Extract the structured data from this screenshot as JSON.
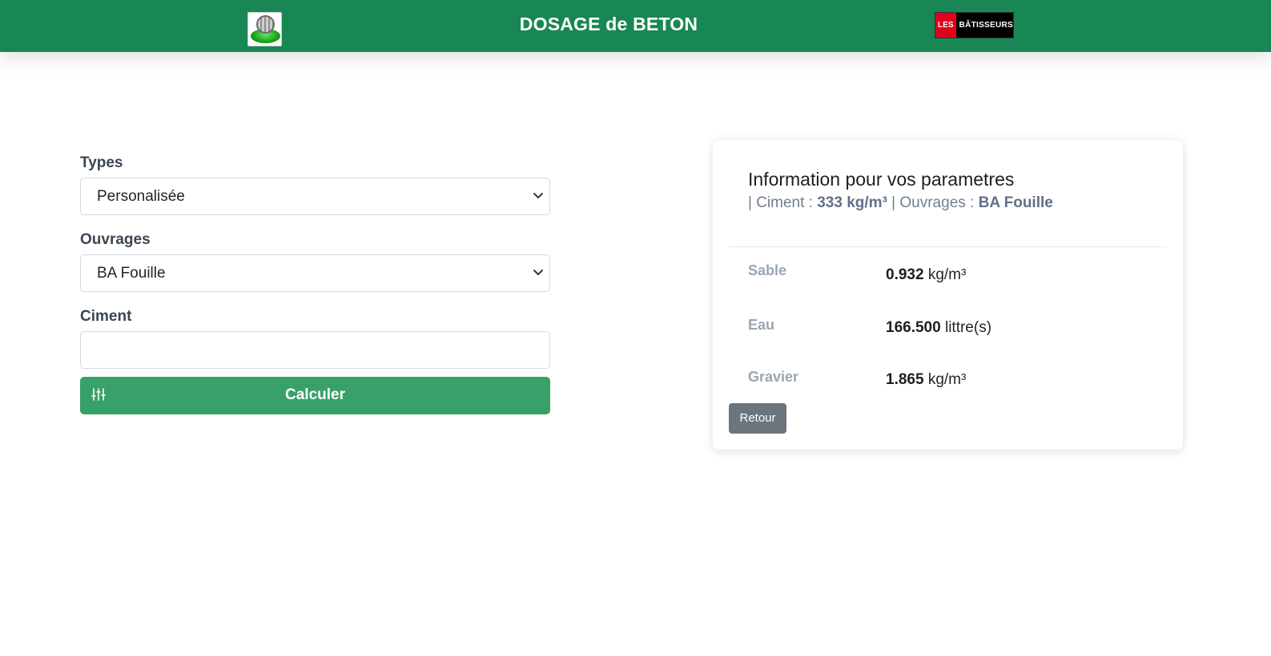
{
  "header": {
    "title": "DOSAGE de BETON",
    "logo_right": {
      "part1": "LES",
      "part2": "BÂTISSEURS"
    }
  },
  "form": {
    "types_label": "Types",
    "types_value": "Personalisée",
    "ouvrages_label": "Ouvrages",
    "ouvrages_value": "BA Fouille",
    "ciment_label": "Ciment",
    "ciment_value": "",
    "calc_button": "Calculer"
  },
  "result": {
    "title": "Information pour vos parametres",
    "sub_prefix_ciment": "| Ciment : ",
    "ciment_value": "333 kg/m³",
    "sub_prefix_ouvrages": " | Ouvrages : ",
    "ouvrages_value": "BA Fouille",
    "rows": [
      {
        "label": "Sable",
        "value": "0.932",
        "unit": "kg/m³"
      },
      {
        "label": "Eau",
        "value": "166.500",
        "unit": "littre(s)"
      },
      {
        "label": "Gravier",
        "value": "1.865",
        "unit": "kg/m³"
      }
    ],
    "back_button": "Retour"
  },
  "colors": {
    "header_bg": "#198754",
    "button_green": "#38a169",
    "button_gray": "#6c757d"
  }
}
